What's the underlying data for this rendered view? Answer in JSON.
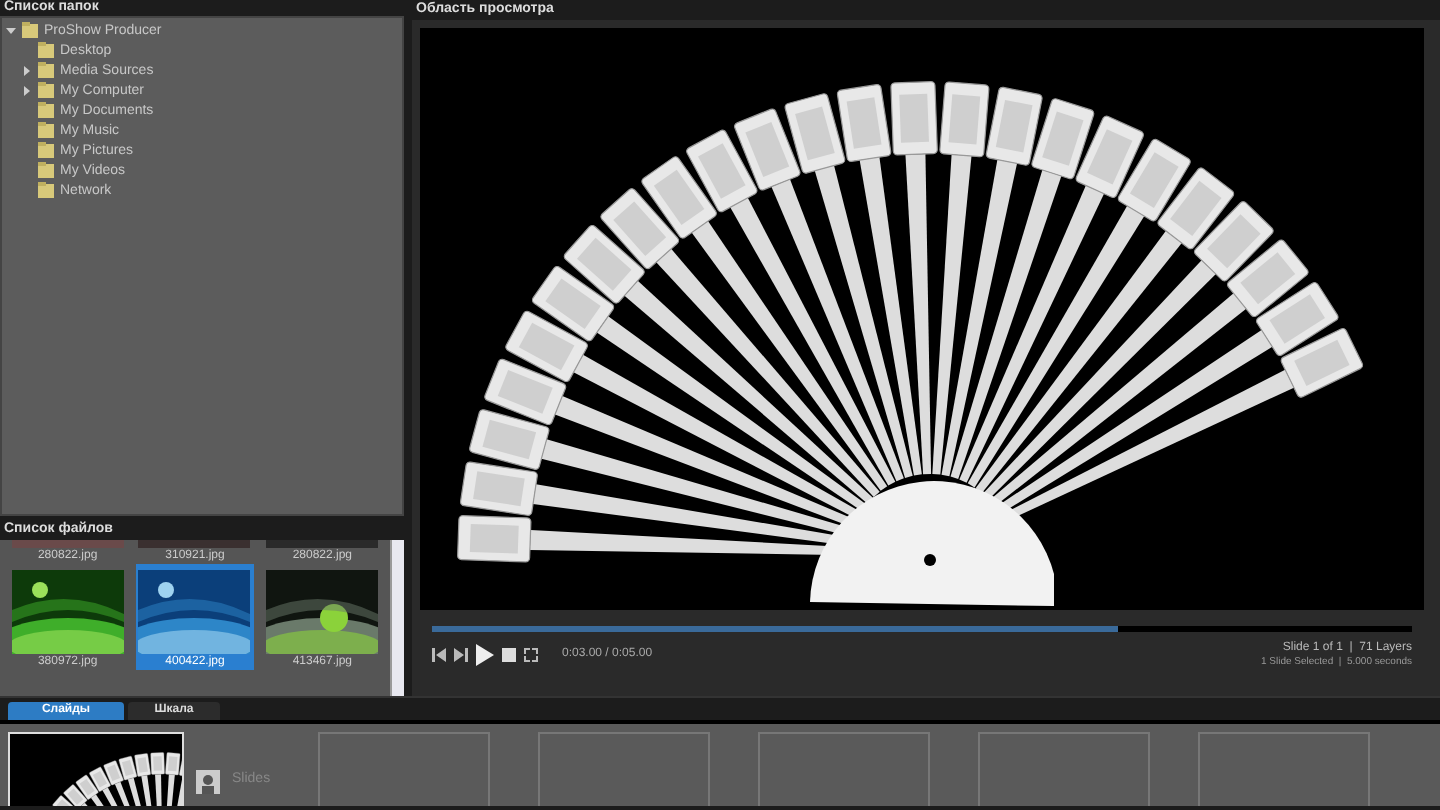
{
  "folders": {
    "title": "Список папок",
    "tree": [
      {
        "label": "ProShow Producer",
        "expanded": true,
        "children": [
          {
            "label": "Desktop"
          },
          {
            "label": "Media Sources",
            "expanded": false
          },
          {
            "label": "My Computer",
            "expanded": false
          },
          {
            "label": "My Documents"
          },
          {
            "label": "My Music"
          },
          {
            "label": "My Pictures"
          },
          {
            "label": "My Videos"
          },
          {
            "label": "Network"
          }
        ]
      }
    ]
  },
  "files": {
    "title": "Список файлов",
    "items": [
      {
        "label": "280822.jpg",
        "kind": "partial",
        "selected": false
      },
      {
        "label": "310921.jpg",
        "kind": "partial",
        "selected": false
      },
      {
        "label": "280822.jpg",
        "kind": "partial",
        "selected": false
      },
      {
        "label": "380972.jpg",
        "kind": "full",
        "selected": false
      },
      {
        "label": "400422.jpg",
        "kind": "full",
        "selected": true
      },
      {
        "label": "413467.jpg",
        "kind": "full",
        "selected": false
      }
    ]
  },
  "preview": {
    "title": "Область просмотра",
    "progress": {
      "level": 0.7
    },
    "time": "0:03.00 / 0:05.00",
    "slide_info": "Slide 1 of 1  |  71 Layers",
    "selection_info": "1 Slide Selected  |  5.000 seconds"
  },
  "bottom": {
    "tabs": [
      {
        "label": "Слайды",
        "selected": true
      },
      {
        "label": "Шкала",
        "selected": false
      }
    ],
    "slides": [
      {
        "selected": true
      }
    ],
    "slides_label": "Slides"
  }
}
